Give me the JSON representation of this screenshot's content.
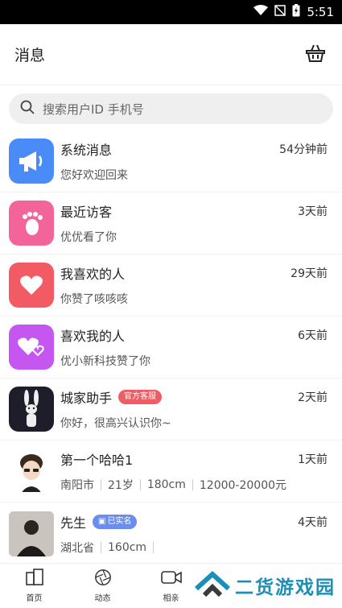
{
  "statusbar": {
    "time": "5:51"
  },
  "header": {
    "title": "消息"
  },
  "search": {
    "placeholder": "搜索用户ID 手机号"
  },
  "messages": [
    {
      "name": "系统消息",
      "preview": "您好欢迎回来",
      "time": "54分钟前",
      "icon": "megaphone-icon",
      "color": "#4a8cf7"
    },
    {
      "name": "最近访客",
      "preview": "优优看了你",
      "time": "3天前",
      "icon": "footprint-icon",
      "color": "#f2649a"
    },
    {
      "name": "我喜欢的人",
      "preview": "你赞了咳咳咳",
      "time": "29天前",
      "icon": "heart-icon",
      "color": "#f25a64"
    },
    {
      "name": "喜欢我的人",
      "preview": "优小新科技赞了你",
      "time": "6天前",
      "icon": "hearts-icon",
      "color": "#c656f0"
    },
    {
      "name": "城家助手",
      "badge": "官方客服",
      "preview": "你好，很高兴认识你~",
      "time": "2天前",
      "icon": "rabbit-avatar"
    }
  ],
  "users": [
    {
      "name": "第一个哈哈1",
      "time": "1天前",
      "info": [
        "南阳市",
        "21岁",
        "180cm",
        "12000-20000元"
      ]
    },
    {
      "name": "先生",
      "badge": "已实名",
      "time": "4天前",
      "info": [
        "湖北省",
        "160cm"
      ]
    }
  ],
  "tabbar": [
    {
      "label": "首页",
      "icon": "home-icon"
    },
    {
      "label": "动态",
      "icon": "aperture-icon"
    },
    {
      "label": "相亲",
      "icon": "video-icon"
    }
  ],
  "watermark": {
    "text": "二货游戏园"
  }
}
